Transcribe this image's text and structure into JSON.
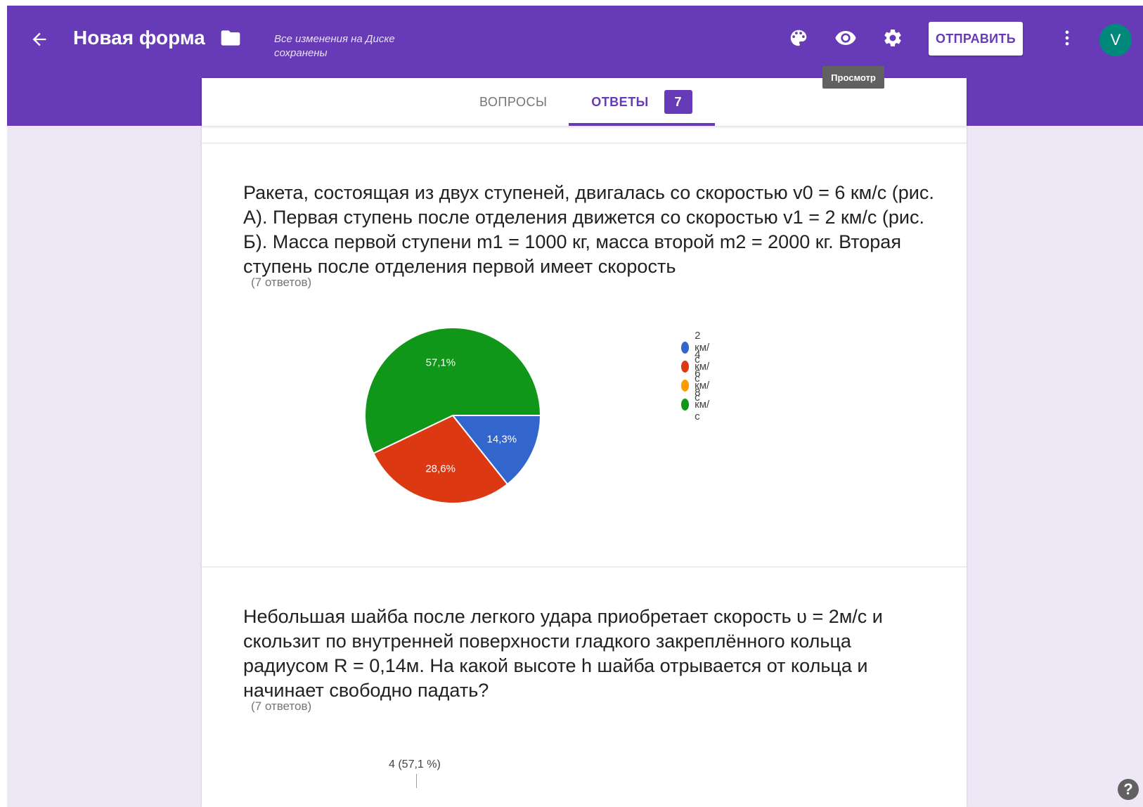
{
  "header": {
    "back_icon": "arrow-back-icon",
    "title": "Новая форма",
    "folder_icon": "folder-icon",
    "save_status": "Все изменения на Диске сохранены",
    "palette_icon": "palette-icon",
    "preview_icon": "eye-icon",
    "settings_icon": "gear-icon",
    "send_label": "ОТПРАВИТЬ",
    "more_icon": "more-vert-icon",
    "avatar_letter": "V",
    "tooltip": "Просмотр",
    "colors": {
      "bar": "#673ab7",
      "background": "#ede7f6",
      "avatar": "#00897b"
    }
  },
  "tabs": {
    "questions_label": "ВОПРОСЫ",
    "answers_label": "ОТВЕТЫ",
    "answers_count": "7",
    "active": "answers"
  },
  "questions": [
    {
      "text": "Ракета, состоящая из двух ступеней, двигалась со скоростью v0 = 6 км/с (рис. А). Первая ступень после отделения движется со скоростью v1 = 2 км/с (рис. Б). Масса первой ступени m1 = 1000 кг, масса второй m2 = 2000 кг. Вторая ступень после отделения первой имеет скорость",
      "responses": "(7 ответов)"
    },
    {
      "text": "Небольшая шайба после легкого удара приобретает скорость υ = 2м/с и скользит по внутренней поверхности гладкого закреплённого кольца радиусом R = 0,14м. На какой высоте h шайба отрывается от кольца и начинает свободно падать?",
      "responses": "(7 ответов)",
      "partial_label": "4 (57,1 %)"
    }
  ],
  "chart_data": {
    "type": "pie",
    "categories": [
      "2 км/с",
      "4 км/с",
      "6 км/с",
      "8 км/с"
    ],
    "values": [
      14.3,
      28.6,
      0,
      57.1
    ],
    "labels": [
      "14,3%",
      "28,6%",
      "",
      "57,1%"
    ],
    "colors": [
      "#3366cc",
      "#dc3912",
      "#ff9900",
      "#109618"
    ],
    "legend_position": "right"
  }
}
